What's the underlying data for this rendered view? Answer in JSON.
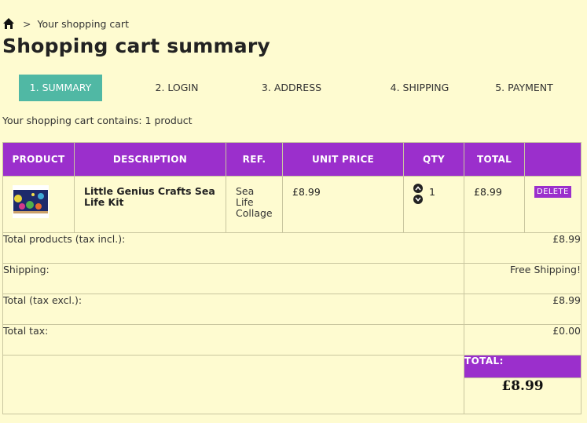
{
  "breadcrumb": {
    "separator": ">",
    "current": "Your shopping cart"
  },
  "page_title": "Shopping cart summary",
  "steps": [
    {
      "label": "1. SUMMARY"
    },
    {
      "label": "2. LOGIN"
    },
    {
      "label": "3. ADDRESS"
    },
    {
      "label": "4. SHIPPING"
    },
    {
      "label": "5. PAYMENT"
    }
  ],
  "cart_summary_text": "Your shopping cart contains: 1 product",
  "table": {
    "headers": {
      "product": "PRODUCT",
      "description": "DESCRIPTION",
      "ref": "REF.",
      "unit_price": "UNIT PRICE",
      "qty": "QTY",
      "total": "TOTAL"
    },
    "item": {
      "name": "Little Genius Crafts Sea Life Kit",
      "ref_line1": "Sea",
      "ref_line2": "Life",
      "ref_line3": "Collage",
      "unit_price": "£8.99",
      "qty": "1",
      "total": "£8.99",
      "delete_label": "DELETE"
    },
    "totals": {
      "products_label": "Total products (tax incl.):",
      "products_value": "£8.99",
      "shipping_label": "Shipping:",
      "shipping_value": "Free Shipping!",
      "excl_label": "Total (tax excl.):",
      "excl_value": "£8.99",
      "tax_label": "Total tax:",
      "tax_value": "£0.00",
      "grand_label": "TOTAL:",
      "grand_value": "£8.99"
    }
  },
  "colors": {
    "accent": "#9b2fcc",
    "active_step": "#50b8a4",
    "background": "#fefbd0"
  }
}
